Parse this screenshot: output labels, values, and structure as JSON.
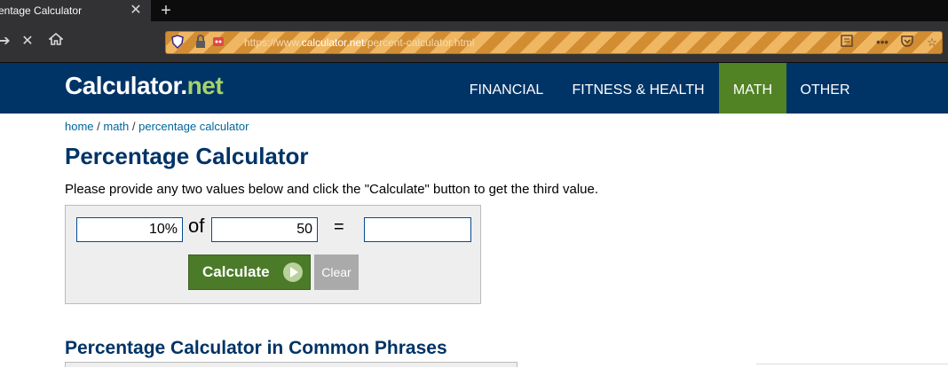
{
  "browser": {
    "tab_title": "entage Calculator",
    "close_glyph": "✕",
    "new_tab_glyph": "+",
    "url_host_prefix": "https://www.",
    "url_host": "calculator.net",
    "url_path": "/percent-calculator.html"
  },
  "site": {
    "logo_main": "Calculator.",
    "logo_net": "net",
    "nav": [
      "FINANCIAL",
      "FITNESS & HEALTH",
      "MATH",
      "OTHER"
    ],
    "active_nav": "MATH",
    "accent_color": "#003366",
    "active_color": "#518325"
  },
  "breadcrumb": {
    "home": "home",
    "sep1": " / ",
    "math": "math",
    "sep2": " / ",
    "current": "percentage calculator"
  },
  "page": {
    "title": "Percentage Calculator",
    "description": "Please provide any two values below and click the \"Calculate\" button to get the third value."
  },
  "calculator": {
    "percent_value": "10",
    "percent_sign": "%",
    "of_label": "of",
    "base_value": "50",
    "equals_label": "=",
    "result_value": "",
    "calculate_label": "Calculate",
    "clear_label": "Clear"
  },
  "section2": {
    "title": "Percentage Calculator in Common Phrases"
  }
}
